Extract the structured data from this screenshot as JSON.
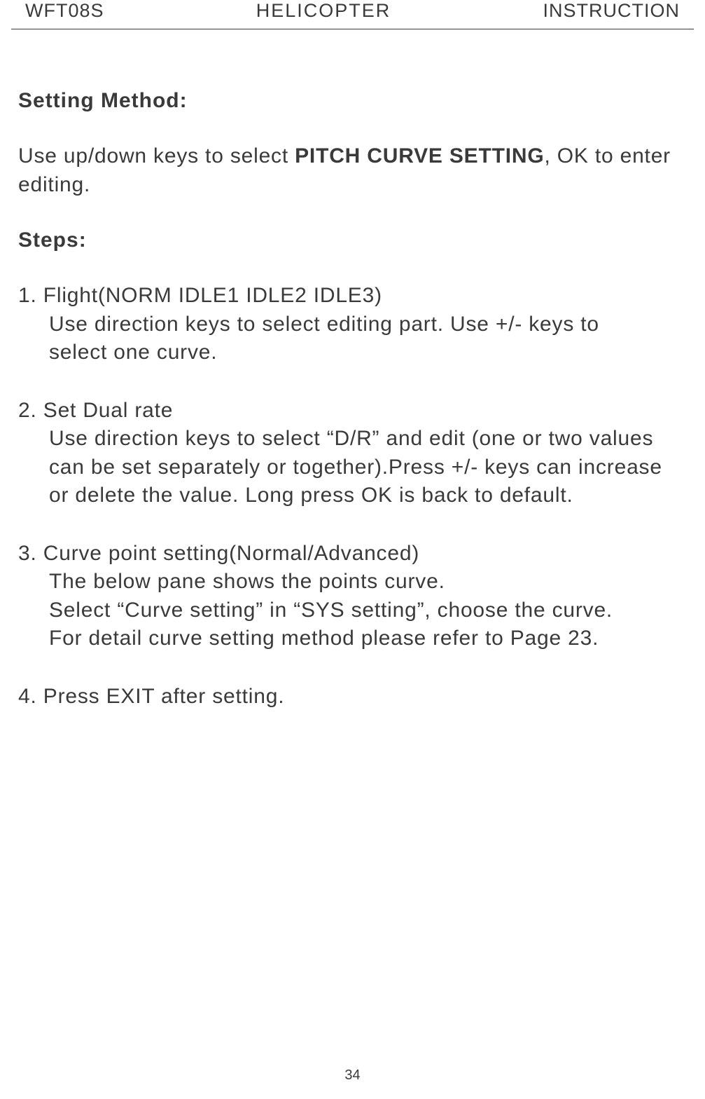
{
  "header": {
    "left": "WFT08S",
    "center": "HELICOPTER",
    "right": "INSTRUCTION"
  },
  "content": {
    "setting_method_heading": "Setting Method:",
    "intro_prefix": "Use up/down keys to select ",
    "intro_bold": "PITCH CURVE SETTING",
    "intro_suffix": ", OK to enter editing.",
    "steps_heading": "Steps:",
    "step1": {
      "title": "1. Flight(NORM IDLE1 IDLE2 IDLE3)",
      "line1": "Use direction keys to select editing part. Use +/- keys to",
      "line2": "select one curve."
    },
    "step2": {
      "title": "2. Set Dual rate",
      "line1": "Use direction keys to select “D/R” and edit (one or two values",
      "line2": "can be set separately or together).Press +/- keys can increase",
      "line3": "or delete the value. Long press OK is back to default."
    },
    "step3": {
      "title": "3. Curve point setting(Normal/Advanced)",
      "line1": "The below pane shows the points curve.",
      "line2": "Select “Curve setting” in “SYS setting”, choose the curve.",
      "line3": "For detail curve setting method please refer to Page 23."
    },
    "step4": {
      "title": "4. Press EXIT after setting."
    }
  },
  "page_number": "34"
}
